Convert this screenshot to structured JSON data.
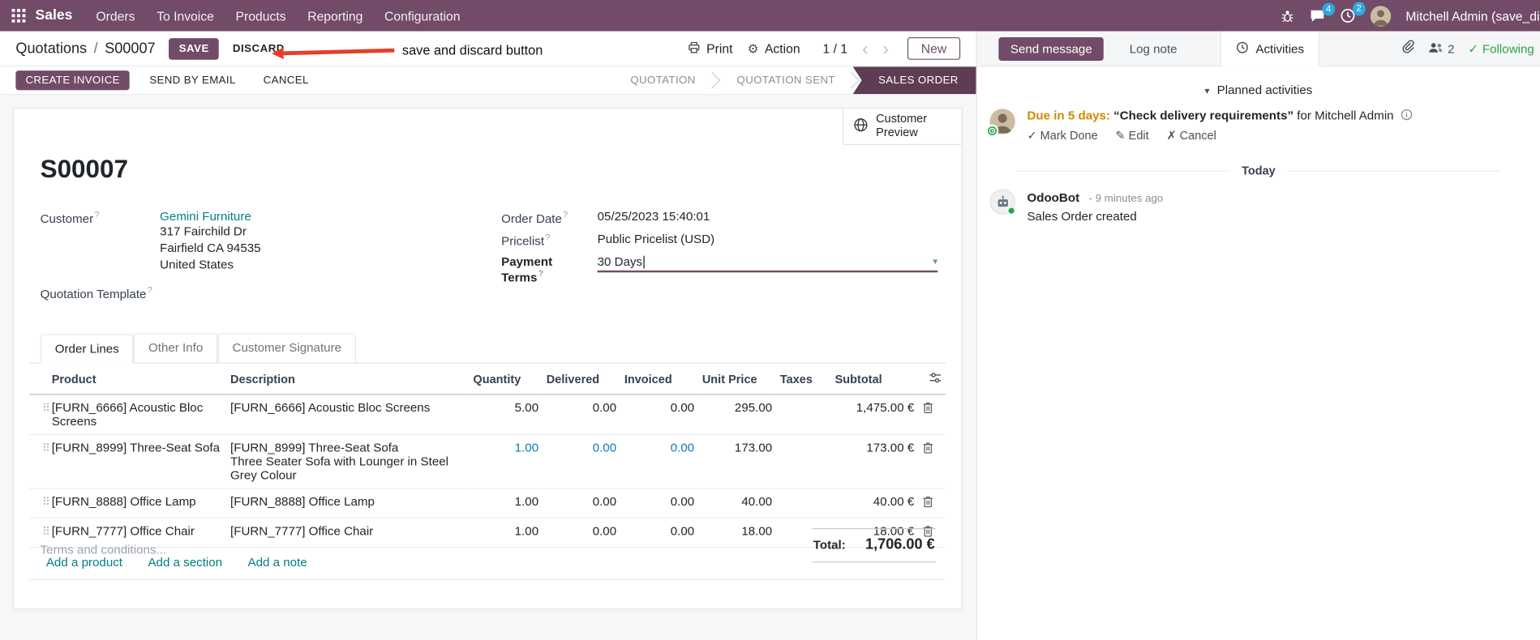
{
  "topbar": {
    "brand": "Sales",
    "menus": [
      "Orders",
      "To Invoice",
      "Products",
      "Reporting",
      "Configuration"
    ],
    "message_badge": "4",
    "activity_badge": "2",
    "user_name": "Mitchell Admin (save_discar"
  },
  "control": {
    "breadcrumb_parent": "Quotations",
    "breadcrumb_sep": "/",
    "breadcrumb_current": "S00007",
    "save": "SAVE",
    "discard": "DISCARD",
    "print": "Print",
    "action": "Action",
    "pager": "1 / 1",
    "new": "New"
  },
  "annotation": {
    "text": "save and discard button"
  },
  "statusbar": {
    "buttons": [
      "CREATE INVOICE",
      "SEND BY EMAIL",
      "CANCEL"
    ],
    "states": [
      "QUOTATION",
      "QUOTATION SENT",
      "SALES ORDER"
    ],
    "active_state": "SALES ORDER"
  },
  "sheet": {
    "preview_button": "Customer Preview",
    "title": "S00007",
    "fields": {
      "customer_label": "Customer",
      "customer_name": "Gemini Furniture",
      "address_line1": "317 Fairchild Dr",
      "address_line2": "Fairfield CA 94535",
      "address_line3": "United States",
      "quotation_template_label": "Quotation Template",
      "order_date_label": "Order Date",
      "order_date": "05/25/2023 15:40:01",
      "pricelist_label": "Pricelist",
      "pricelist": "Public Pricelist (USD)",
      "payment_terms_label": "Payment Terms",
      "payment_terms": "30 Days"
    },
    "tabs": [
      "Order Lines",
      "Other Info",
      "Customer Signature"
    ],
    "table": {
      "headers": [
        "Product",
        "Description",
        "Quantity",
        "Delivered",
        "Invoiced",
        "Unit Price",
        "Taxes",
        "Subtotal"
      ],
      "rows": [
        {
          "product": "[FURN_6666] Acoustic Bloc Screens",
          "description": "[FURN_6666] Acoustic Bloc Screens",
          "description2": "",
          "quantity": "5.00",
          "delivered": "0.00",
          "invoiced": "0.00",
          "unit_price": "295.00",
          "taxes": "",
          "subtotal": "1,475.00 €"
        },
        {
          "product": "[FURN_8999] Three-Seat Sofa",
          "description": "[FURN_8999] Three-Seat Sofa",
          "description2": "Three Seater Sofa with Lounger in Steel Grey Colour",
          "quantity": "1.00",
          "delivered": "0.00",
          "invoiced": "0.00",
          "unit_price": "173.00",
          "taxes": "",
          "subtotal": "173.00 €"
        },
        {
          "product": "[FURN_8888] Office Lamp",
          "description": "[FURN_8888] Office Lamp",
          "description2": "",
          "quantity": "1.00",
          "delivered": "0.00",
          "invoiced": "0.00",
          "unit_price": "40.00",
          "taxes": "",
          "subtotal": "40.00 €"
        },
        {
          "product": "[FURN_7777] Office Chair",
          "description": "[FURN_7777] Office Chair",
          "description2": "",
          "quantity": "1.00",
          "delivered": "0.00",
          "invoiced": "0.00",
          "unit_price": "18.00",
          "taxes": "",
          "subtotal": "18.00 €"
        }
      ],
      "links": [
        "Add a product",
        "Add a section",
        "Add a note"
      ]
    },
    "terms_placeholder": "Terms and conditions...",
    "total_label": "Total:",
    "total_value": "1,706.00 €"
  },
  "chatter": {
    "send_message": "Send message",
    "log_note": "Log note",
    "activities": "Activities",
    "followers_count": "2",
    "following": "Following",
    "planned_title": "Planned activities",
    "activity": {
      "due": "Due in 5 days:",
      "summary": "“Check delivery requirements”",
      "for_text": "for Mitchell Admin",
      "mark_done": "Mark Done",
      "edit": "Edit",
      "cancel": "Cancel"
    },
    "date_separator": "Today",
    "message": {
      "author": "OdooBot",
      "time": "- 9 minutes ago",
      "body": "Sales Order created"
    }
  },
  "ui": {
    "help_marker": "?"
  },
  "icons": {
    "gear": "⚙",
    "caret_down": "▾",
    "chevron_left": "‹",
    "chevron_right": "›",
    "check": "✓",
    "edit_pencil": "✎",
    "cancel_x": "✗",
    "drag_handle": "⠿"
  },
  "colors": {
    "primary": "#714B67",
    "status_active_bg": "#5e3d54",
    "link_teal": "#017e84",
    "due_warning": "#cc8a00",
    "highlight_cell": "#0d7cb5",
    "following_green": "#28a745",
    "badge_blue": "#2fa8e1",
    "annotation_red": "#e53e2a"
  }
}
